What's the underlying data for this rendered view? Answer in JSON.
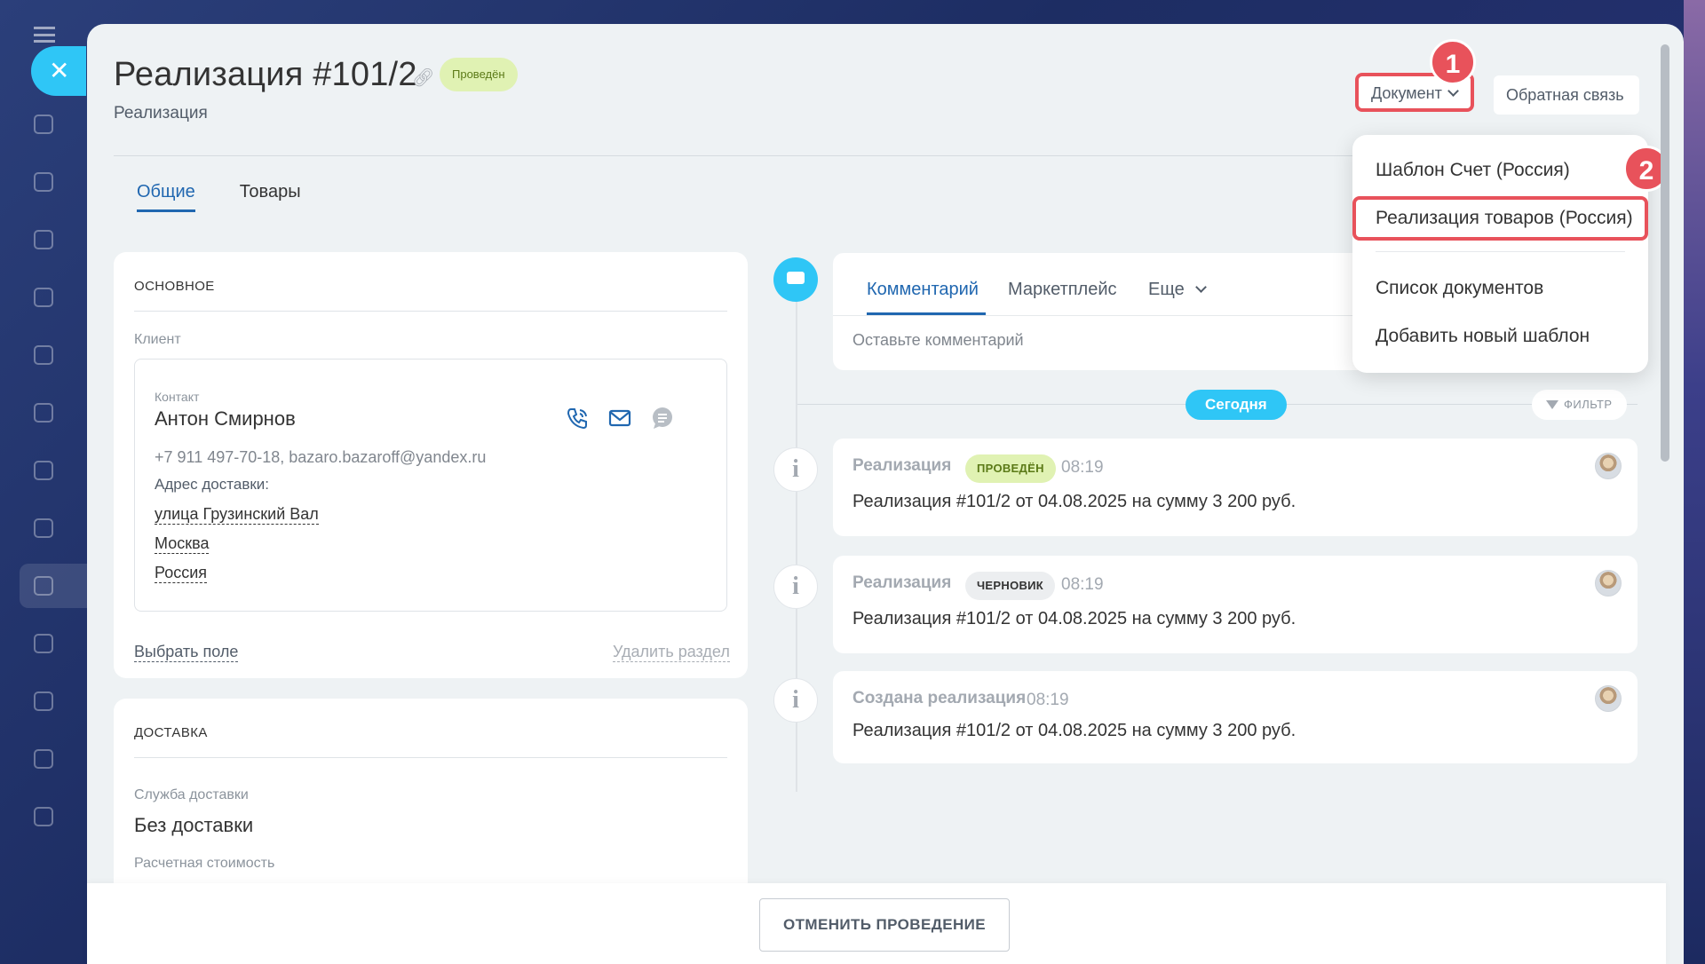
{
  "document": {
    "title": "Реализация #101/2",
    "status": "Проведён",
    "subtitle": "Реализация"
  },
  "header": {
    "document_button": "Документ",
    "feedback_button": "Обратная связь",
    "marker_1": "1",
    "marker_2": "2"
  },
  "dropdown": {
    "items": [
      "Шаблон Счет (Россия)",
      "Реализация товаров (Россия)",
      "Список документов",
      "Добавить новый шаблон"
    ]
  },
  "tabs": [
    {
      "label": "Общие",
      "active": true
    },
    {
      "label": "Товары",
      "active": false
    }
  ],
  "main_section": {
    "title": "ОСНОВНОЕ",
    "client_label": "Клиент",
    "contact": {
      "type": "Контакт",
      "name": "Антон Смирнов",
      "info": "+7 911 497-70-18, bazaro.bazaroff@yandex.ru",
      "address_label": "Адрес доставки:",
      "address": [
        "улица Грузинский Вал",
        "Москва",
        "Россия"
      ]
    },
    "choose_field": "Выбрать поле",
    "delete_section": "Удалить раздел"
  },
  "delivery_section": {
    "title": "ДОСТАВКА",
    "service_label": "Служба доставки",
    "service_value": "Без доставки",
    "cost_label": "Расчетная стоимость"
  },
  "timeline": {
    "comment_tabs": [
      "Комментарий",
      "Маркетплейс",
      "Еще"
    ],
    "comment_placeholder": "Оставьте комментарий",
    "today": "Сегодня",
    "filter": "ФИЛЬТР",
    "events": [
      {
        "title": "Реализация",
        "badge": "ПРОВЕДЁН",
        "time": "08:19",
        "text": "Реализация #101/2 от 04.08.2025 на сумму 3 200 руб."
      },
      {
        "title": "Реализация",
        "badge": "ЧЕРНОВИК",
        "time": "08:19",
        "text": "Реализация #101/2 от 04.08.2025 на сумму 3 200 руб."
      },
      {
        "title": "Создана реализация",
        "badge": "",
        "time": "08:19",
        "text": "Реализация #101/2 от 04.08.2025 на сумму 3 200 руб."
      }
    ]
  },
  "footer": {
    "cancel_button": "ОТМЕНИТЬ ПРОВЕДЕНИЕ"
  },
  "colors": {
    "accent": "#2067b0",
    "highlight_red": "#e8525b",
    "timeline_blue": "#2fc6f6",
    "status_green_bg": "#e0f2b3"
  }
}
